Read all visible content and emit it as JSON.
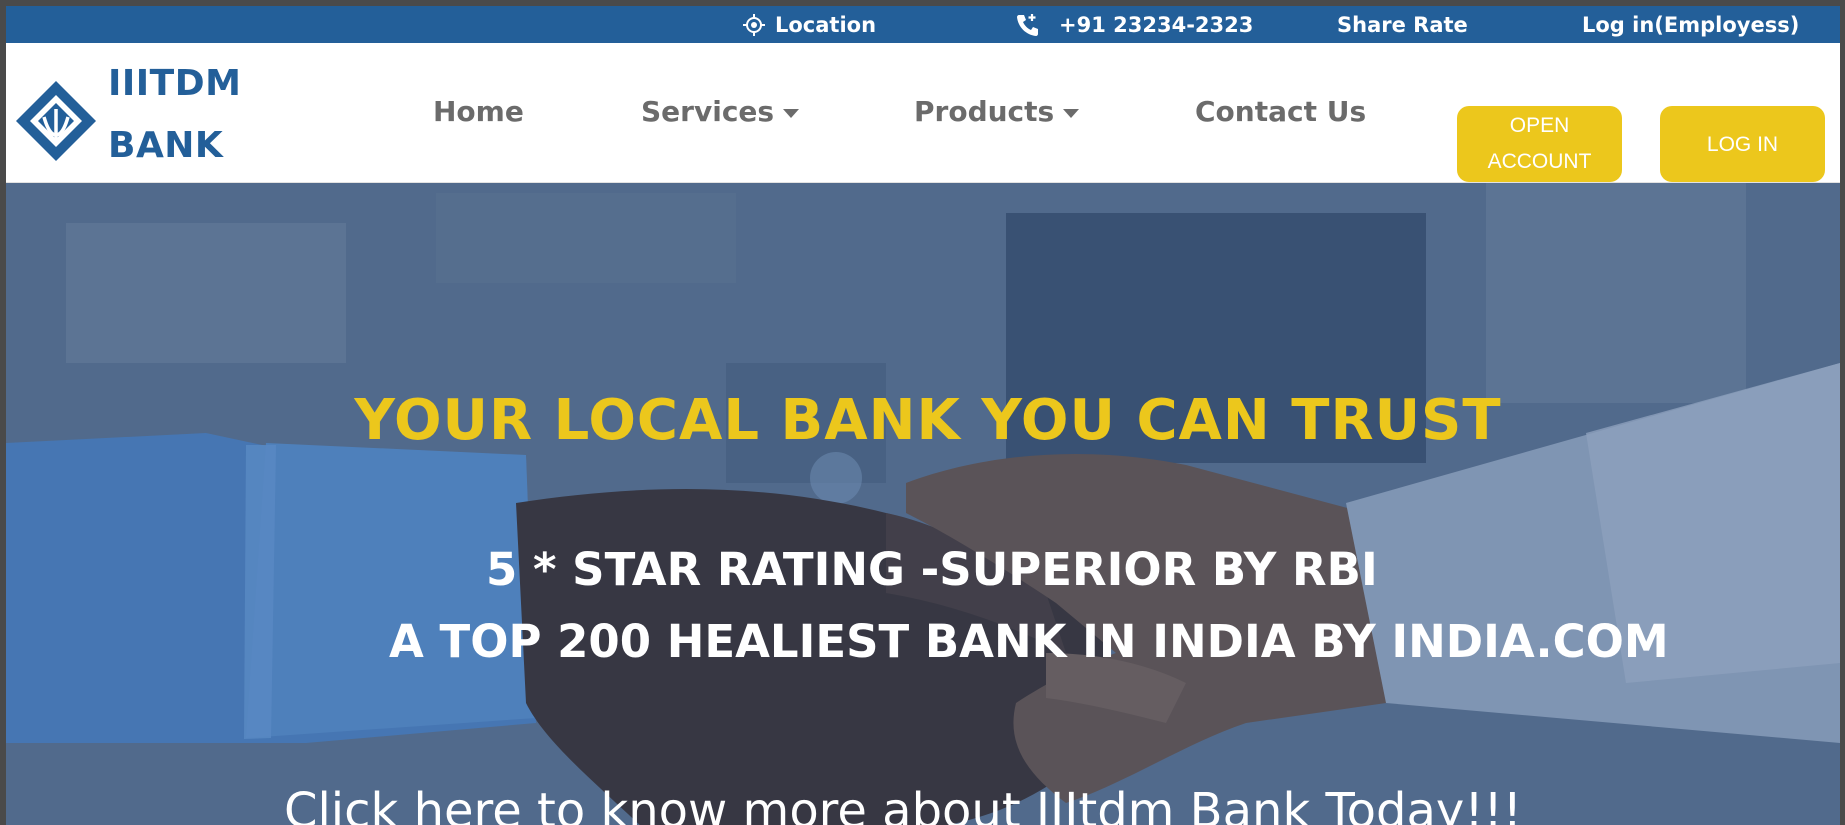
{
  "topbar": {
    "location_label": "Location",
    "phone_label": "+91 23234-2323",
    "share_rate_label": "Share Rate",
    "employee_login_label": "Log in(Employess)",
    "background_color": "#235f99"
  },
  "header": {
    "logo": {
      "line1": "IIITDM",
      "line2": "BANK",
      "color": "#235f99"
    },
    "nav": {
      "home": "Home",
      "services": "Services",
      "products": "Products",
      "contact": "Contact Us"
    },
    "buttons": {
      "open_account_line1": "OPEN",
      "open_account_line2": "ACCOUNT",
      "login": "LOG IN",
      "color": "#ecc71c"
    }
  },
  "hero": {
    "headline": "YOUR LOCAL BANK YOU CAN TRUST",
    "line1": "5 * STAR RATING -SUPERIOR BY RBI",
    "line2": "A TOP 200 HEALIEST BANK IN INDIA BY INDIA.COM",
    "cta": "Click here to know more about IIItdm Bank Today!!!",
    "headline_color": "#ecc71c"
  },
  "icons": {
    "location": "crosshair-location-icon",
    "phone": "phone-call-icon",
    "dropdown": "caret-down-icon"
  }
}
